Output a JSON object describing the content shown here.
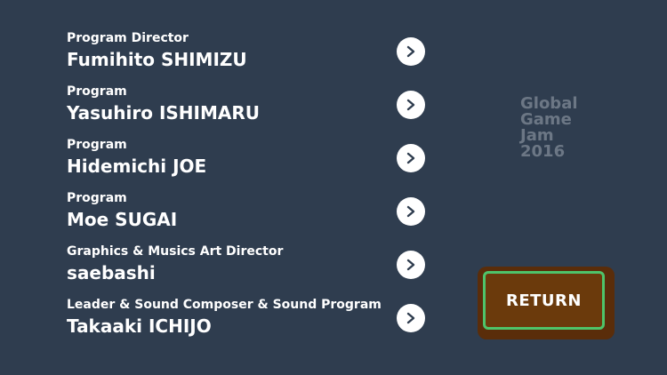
{
  "credits": [
    {
      "role": "Program Director",
      "name": "Fumihito SHIMIZU"
    },
    {
      "role": "Program",
      "name": "Yasuhiro ISHIMARU"
    },
    {
      "role": "Program",
      "name": "Hidemichi JOE"
    },
    {
      "role": "Program",
      "name": "Moe SUGAI"
    },
    {
      "role": "Graphics & Musics Art Director",
      "name": "saebashi"
    },
    {
      "role": "Leader & Sound Composer & Sound Program",
      "name": "Takaaki ICHIJO"
    }
  ],
  "event_title": {
    "line1": "Global",
    "line2": "Game",
    "line3": "Jam",
    "line4": "2016"
  },
  "return_button": {
    "label": "RETURN"
  },
  "icons": {
    "link_arrow": "chevron-right-icon"
  },
  "colors": {
    "background": "#2f3d4f",
    "text": "#ffffff",
    "event_title": "#6c7785",
    "button_fill": "#6b3a0c",
    "button_border": "#4ec46a",
    "button_frame": "#5a2d0a"
  }
}
